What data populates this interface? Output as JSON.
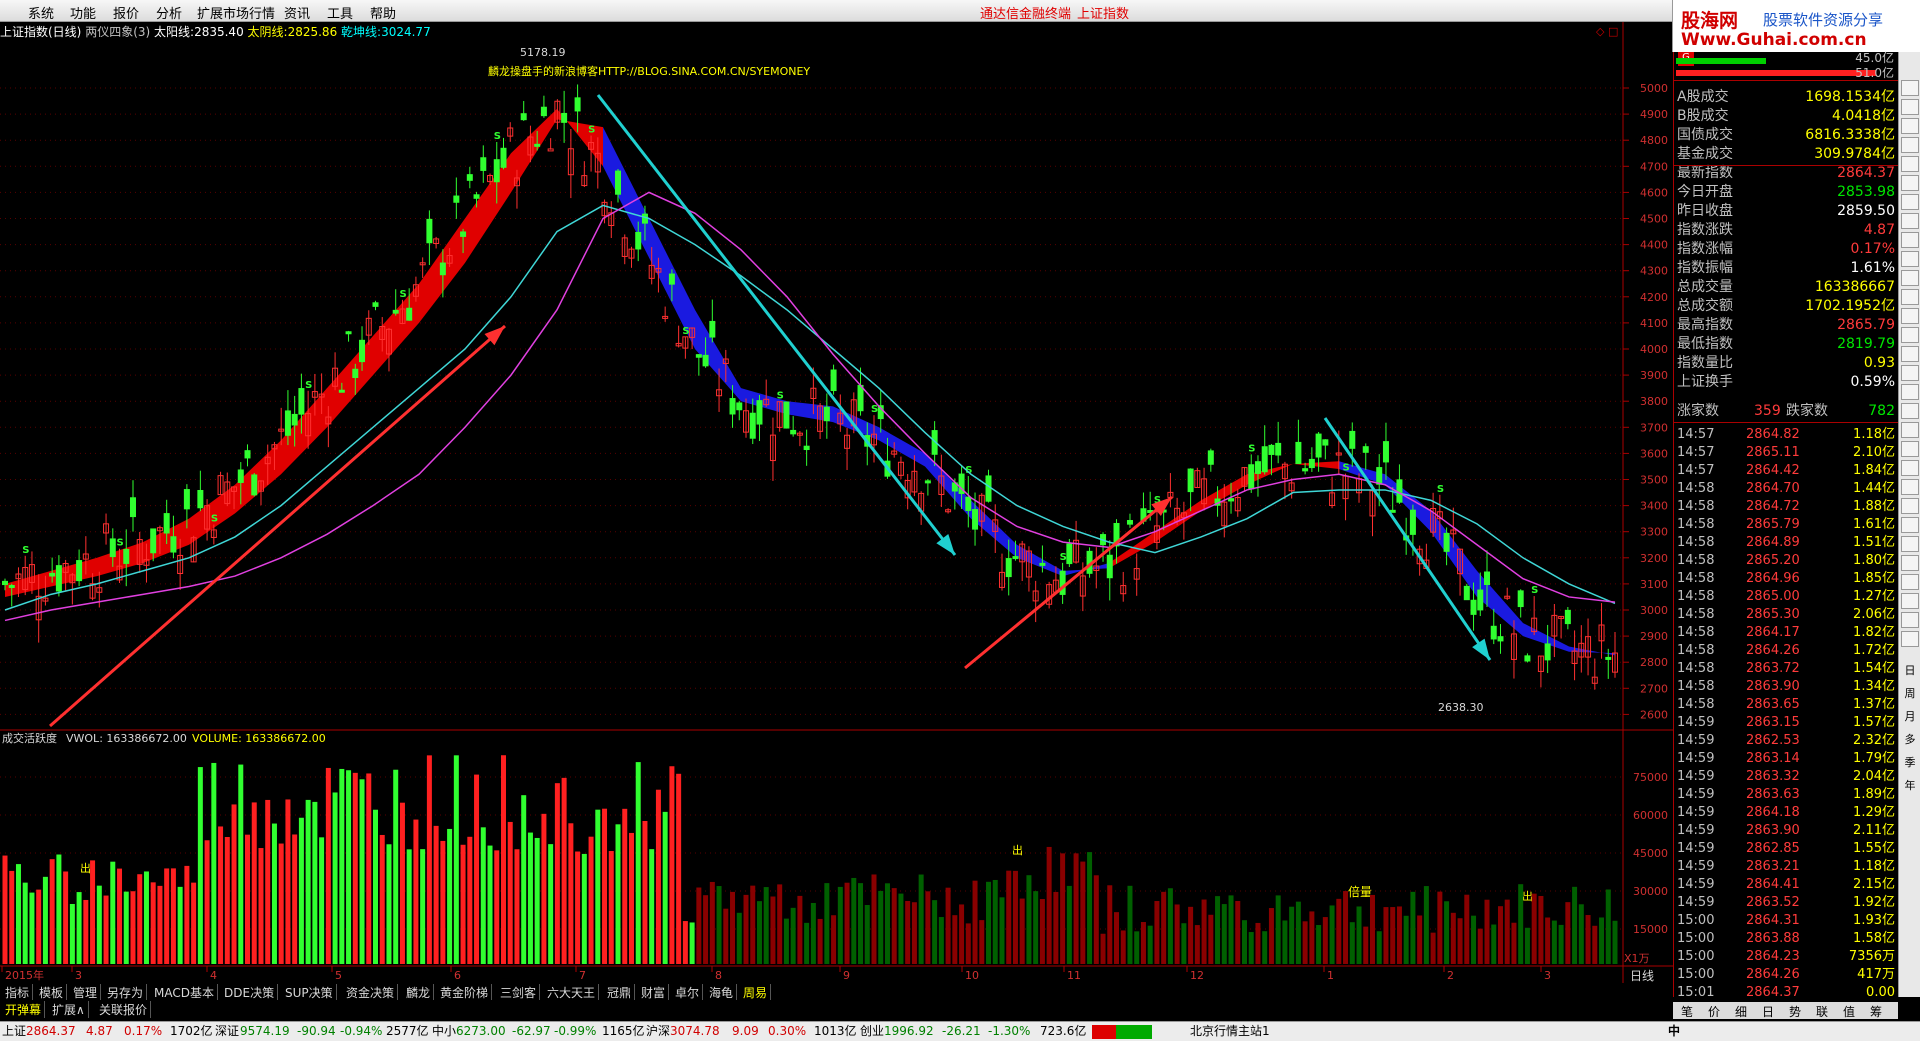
{
  "menu": {
    "items": [
      "系统",
      "功能",
      "报价",
      "分析",
      "扩展市场行情",
      "资讯",
      "工具",
      "帮助"
    ],
    "center": "通达信金融终端",
    "center2": "上证指数"
  },
  "brand": {
    "line1": "股海网",
    "line2": "股票软件资源分享",
    "line3": "Www.Guhai.com.cn"
  },
  "info": {
    "title": "上证指数(日线)",
    "formula": "两仪四象(3)",
    "sun_label": "太阳线:",
    "sun_value": "2835.40",
    "moon_label": "太阴线:",
    "moon_value": "2825.86",
    "qiankun_label": "乾坤线:",
    "qiankun_value": "3024.77"
  },
  "annotations": {
    "high": "5178.19",
    "low": "2638.30",
    "blog": "麟龙操盘手的新浪博客HTTP://BLOG.SINA.COM.CN/SYEMONEY",
    "beiliang": "倍量",
    "chu": "出",
    "s": "S"
  },
  "axis": {
    "price_ticks": [
      "5000",
      "4900",
      "4800",
      "4700",
      "4600",
      "4500",
      "4400",
      "4300",
      "4200",
      "4100",
      "4000",
      "3900",
      "3800",
      "3700",
      "3600",
      "3500",
      "3400",
      "3300",
      "3200",
      "3100",
      "3000",
      "2900",
      "2800",
      "2700",
      "2600"
    ],
    "vol_ticks": [
      "75000",
      "60000",
      "45000",
      "30000",
      "15000"
    ],
    "vol_unit": "X1万",
    "months": [
      "2015年",
      "3",
      "4",
      "5",
      "6",
      "7",
      "8",
      "9",
      "10",
      "11",
      "12",
      "1",
      "2",
      "3"
    ],
    "period": "日线"
  },
  "volume_panel": {
    "title": "成交活跃度",
    "vwol_label": "VWOL:",
    "vwol_value": "163386672.00",
    "volume_label": "VOLUME:",
    "volume_value": "163386672.00"
  },
  "right_panel": {
    "top_values": [
      "45.0亿",
      "51.0亿"
    ],
    "rows": [
      {
        "label": "A股成交",
        "value": "1698.1534亿",
        "color": "#ffff00"
      },
      {
        "label": "B股成交",
        "value": "4.0418亿",
        "color": "#ffff00"
      },
      {
        "label": "国债成交",
        "value": "6816.3338亿",
        "color": "#ffff00"
      },
      {
        "label": "基金成交",
        "value": "309.9784亿",
        "color": "#ffff00"
      },
      {
        "label": "最新指数",
        "value": "2864.37",
        "color": "#ff3b3b"
      },
      {
        "label": "今日开盘",
        "value": "2853.98",
        "color": "#00e600"
      },
      {
        "label": "昨日收盘",
        "value": "2859.50",
        "color": "#ffffff"
      },
      {
        "label": "指数涨跌",
        "value": "4.87",
        "color": "#ff3b3b"
      },
      {
        "label": "指数涨幅",
        "value": "0.17%",
        "color": "#ff3b3b"
      },
      {
        "label": "指数振幅",
        "value": "1.61%",
        "color": "#ffffff"
      },
      {
        "label": "总成交量",
        "value": "163386667",
        "color": "#ffff00"
      },
      {
        "label": "总成交额",
        "value": "1702.1952亿",
        "color": "#ffff00"
      },
      {
        "label": "最高指数",
        "value": "2865.79",
        "color": "#ff3b3b"
      },
      {
        "label": "最低指数",
        "value": "2819.79",
        "color": "#00e600"
      },
      {
        "label": "指数量比",
        "value": "0.93",
        "color": "#ffff00"
      },
      {
        "label": "上证换手",
        "value": "0.59%",
        "color": "#ffffff"
      }
    ],
    "updown": {
      "up_label": "涨家数",
      "up_value": "359",
      "down_label": "跌家数",
      "down_value": "782"
    },
    "ticks": [
      {
        "t": "14:57",
        "p": "2864.82",
        "v": "1.18亿"
      },
      {
        "t": "14:57",
        "p": "2865.11",
        "v": "2.10亿"
      },
      {
        "t": "14:57",
        "p": "2864.42",
        "v": "1.84亿"
      },
      {
        "t": "14:58",
        "p": "2864.70",
        "v": "1.44亿"
      },
      {
        "t": "14:58",
        "p": "2864.72",
        "v": "1.88亿"
      },
      {
        "t": "14:58",
        "p": "2865.79",
        "v": "1.61亿"
      },
      {
        "t": "14:58",
        "p": "2864.89",
        "v": "1.51亿"
      },
      {
        "t": "14:58",
        "p": "2865.20",
        "v": "1.80亿"
      },
      {
        "t": "14:58",
        "p": "2864.96",
        "v": "1.85亿"
      },
      {
        "t": "14:58",
        "p": "2865.00",
        "v": "1.27亿"
      },
      {
        "t": "14:58",
        "p": "2865.30",
        "v": "2.06亿"
      },
      {
        "t": "14:58",
        "p": "2864.17",
        "v": "1.82亿"
      },
      {
        "t": "14:58",
        "p": "2864.26",
        "v": "1.72亿"
      },
      {
        "t": "14:58",
        "p": "2863.72",
        "v": "1.54亿"
      },
      {
        "t": "14:58",
        "p": "2863.90",
        "v": "1.34亿"
      },
      {
        "t": "14:58",
        "p": "2863.65",
        "v": "1.37亿"
      },
      {
        "t": "14:59",
        "p": "2863.15",
        "v": "1.57亿"
      },
      {
        "t": "14:59",
        "p": "2862.53",
        "v": "2.32亿"
      },
      {
        "t": "14:59",
        "p": "2863.14",
        "v": "1.79亿"
      },
      {
        "t": "14:59",
        "p": "2863.32",
        "v": "2.04亿"
      },
      {
        "t": "14:59",
        "p": "2863.63",
        "v": "1.89亿"
      },
      {
        "t": "14:59",
        "p": "2864.18",
        "v": "1.29亿"
      },
      {
        "t": "14:59",
        "p": "2863.90",
        "v": "2.11亿"
      },
      {
        "t": "14:59",
        "p": "2862.85",
        "v": "1.55亿"
      },
      {
        "t": "14:59",
        "p": "2863.21",
        "v": "1.18亿"
      },
      {
        "t": "14:59",
        "p": "2864.41",
        "v": "2.15亿"
      },
      {
        "t": "14:59",
        "p": "2863.52",
        "v": "1.92亿"
      },
      {
        "t": "15:00",
        "p": "2864.31",
        "v": "1.93亿"
      },
      {
        "t": "15:00",
        "p": "2863.88",
        "v": "1.58亿"
      },
      {
        "t": "15:00",
        "p": "2864.23",
        "v": "7356万"
      },
      {
        "t": "15:00",
        "p": "2864.26",
        "v": "417万"
      },
      {
        "t": "15:01",
        "p": "2864.37",
        "v": "0.00"
      }
    ]
  },
  "right_toolbar": [
    "日",
    "周",
    "月",
    "多",
    "季",
    "年"
  ],
  "right_tabs": [
    "笔",
    "价",
    "细",
    "日",
    "势",
    "联",
    "值",
    "筹"
  ],
  "tabs1": [
    "指标",
    "模板",
    "管理",
    "另存为",
    "MACD基本",
    "DDE决策",
    "SUP决策",
    "资金决策",
    "麟龙",
    "黄金阶梯",
    "三剑客",
    "六大天王",
    "冠鼎",
    "财富",
    "卓尔",
    "海龟",
    "周易"
  ],
  "tabs2": [
    "开弹幕",
    "扩展∧",
    "关联报价"
  ],
  "status": {
    "sh_label": "上证",
    "sh_val": "2864.37",
    "sh_chg": "4.87",
    "sh_pct": "0.17%",
    "sh_amt": "1702亿",
    "sz_label": "深证",
    "sz_val": "9574.19",
    "sz_chg": "-90.94",
    "sz_pct": "-0.94%",
    "sz_amt": "2577亿",
    "zx_label": "中小",
    "zx_val": "6273.00",
    "zx_chg": "-62.97",
    "zx_pct": "-0.99%",
    "zx_amt": "1165亿",
    "hs_label": "沪深",
    "hs_val": "3074.78",
    "hs_chg": "9.09",
    "hs_pct": "0.30%",
    "hs_amt": "1013亿",
    "cy_label": "创业",
    "cy_val": "1996.92",
    "cy_chg": "-26.21",
    "cy_pct": "-1.30%",
    "cy_amt": "723.6亿",
    "server": "北京行情主站1",
    "ime": "中"
  },
  "chart_data": {
    "type": "candlestick",
    "price_range": [
      2600,
      5100
    ],
    "sun_line": [
      3100,
      3150,
      3200,
      3260,
      3350,
      3480,
      3650,
      3850,
      4050,
      4250,
      4500,
      4750,
      4920,
      4700,
      4350,
      4000,
      3800,
      3750,
      3720,
      3650,
      3550,
      3350,
      3200,
      3130,
      3180,
      3300,
      3420,
      3520,
      3560,
      3540,
      3480,
      3300,
      3050,
      2900,
      2840,
      2835
    ],
    "moon_line": [
      3050,
      3090,
      3130,
      3180,
      3250,
      3370,
      3520,
      3700,
      3900,
      4100,
      4330,
      4600,
      4880,
      4850,
      4500,
      4150,
      3850,
      3800,
      3780,
      3700,
      3600,
      3420,
      3250,
      3150,
      3160,
      3260,
      3380,
      3480,
      3560,
      3570,
      3520,
      3380,
      3150,
      2950,
      2860,
      2826
    ],
    "qiankun_line": [
      3000,
      3060,
      3100,
      3150,
      3200,
      3280,
      3400,
      3550,
      3700,
      3850,
      4000,
      4200,
      4450,
      4550,
      4500,
      4400,
      4280,
      4150,
      4000,
      3850,
      3680,
      3520,
      3400,
      3320,
      3260,
      3220,
      3280,
      3350,
      3450,
      3460,
      3460,
      3420,
      3330,
      3200,
      3100,
      3025
    ],
    "purple_line": [
      2960,
      3000,
      3030,
      3060,
      3090,
      3130,
      3200,
      3290,
      3400,
      3520,
      3700,
      3900,
      4150,
      4500,
      4600,
      4520,
      4380,
      4200,
      3980,
      3780,
      3600,
      3430,
      3320,
      3260,
      3240,
      3300,
      3380,
      3460,
      3500,
      3520,
      3480,
      3380,
      3250,
      3120,
      3050,
      3030
    ],
    "months": [
      "2015年",
      "3",
      "4",
      "5",
      "6",
      "7",
      "8",
      "9",
      "10",
      "11",
      "12",
      "1",
      "2",
      "3"
    ]
  }
}
